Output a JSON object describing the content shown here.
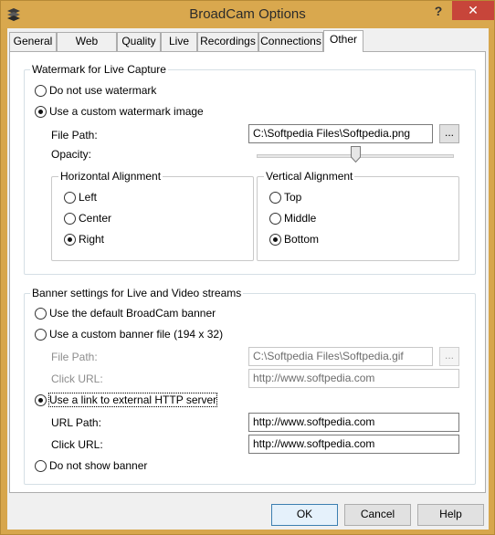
{
  "window": {
    "title": "BroadCam Options",
    "help_glyph": "?",
    "close_glyph": "✕"
  },
  "tabs": [
    {
      "label": "General"
    },
    {
      "label": "Web Access"
    },
    {
      "label": "Quality"
    },
    {
      "label": "Live"
    },
    {
      "label": "Recordings"
    },
    {
      "label": "Connections"
    },
    {
      "label": "Other",
      "selected": true
    }
  ],
  "watermark": {
    "legend": "Watermark for Live Capture",
    "options": [
      {
        "label": "Do not use watermark",
        "checked": false
      },
      {
        "label": "Use a custom watermark image",
        "checked": true
      }
    ],
    "file_path_label": "File Path:",
    "file_path_value": "C:\\Softpedia Files\\Softpedia.png",
    "browse_label": "...",
    "opacity_label": "Opacity:",
    "opacity_value": 0.5,
    "horizontal": {
      "legend": "Horizontal Alignment",
      "options": [
        {
          "label": "Left",
          "checked": false
        },
        {
          "label": "Center",
          "checked": false
        },
        {
          "label": "Right",
          "checked": true
        }
      ]
    },
    "vertical": {
      "legend": "Vertical Alignment",
      "options": [
        {
          "label": "Top",
          "checked": false
        },
        {
          "label": "Middle",
          "checked": false
        },
        {
          "label": "Bottom",
          "checked": true
        }
      ]
    }
  },
  "banner": {
    "legend": "Banner settings for Live and Video streams",
    "default_option": {
      "label": "Use the default BroadCam banner",
      "checked": false
    },
    "custom_option": {
      "label": "Use a custom banner file (194 x 32)",
      "checked": false
    },
    "custom_file_path_label": "File Path:",
    "custom_file_path_value": "C:\\Softpedia Files\\Softpedia.gif",
    "custom_browse_label": "...",
    "custom_click_url_label": "Click URL:",
    "custom_click_url_value": "http://www.softpedia.com",
    "link_option": {
      "label": "Use a link to external HTTP server",
      "checked": true
    },
    "url_path_label": "URL Path:",
    "url_path_value": "http://www.softpedia.com",
    "link_click_url_label": "Click URL:",
    "link_click_url_value": "http://www.softpedia.com",
    "none_option": {
      "label": "Do not show banner",
      "checked": false
    }
  },
  "buttons": {
    "ok": "OK",
    "cancel": "Cancel",
    "help": "Help"
  },
  "colors": {
    "titlebar": "#d9a84e",
    "close": "#c7453a"
  }
}
